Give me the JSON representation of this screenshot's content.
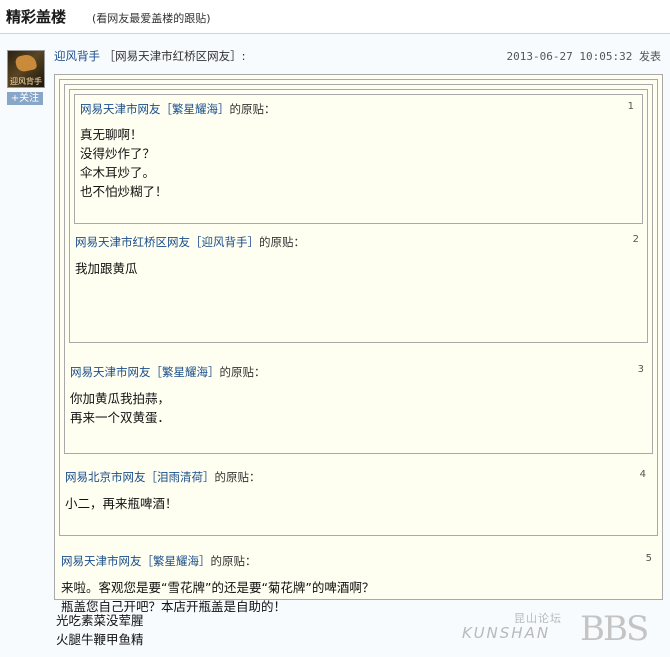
{
  "header": {
    "title": "精彩盖楼",
    "subtitle": "(看网友最爱盖楼的跟贴)"
  },
  "post": {
    "avatar_caption": "迎风背手",
    "follow_label": "+关注",
    "username": "迎风背手",
    "location": "［网易天津市红桥区网友］:",
    "timestamp": "2013-06-27 10:05:32 发表"
  },
  "quotes": [
    {
      "who": "网易天津市网友［繁星耀海］",
      "orig": "的原贴：",
      "num": "1",
      "lines": [
        "真无聊啊！",
        "没得炒作了？",
        "伞木耳炒了。",
        "也不怕炒糊了！"
      ]
    },
    {
      "who": "网易天津市红桥区网友［迎风背手］",
      "orig": "的原贴：",
      "num": "2",
      "lines": [
        "我加跟黄瓜"
      ]
    },
    {
      "who": "网易天津市网友［繁星耀海］",
      "orig": "的原贴：",
      "num": "3",
      "lines": [
        "你加黄瓜我拍蒜，",
        "再来一个双黄蛋．"
      ]
    },
    {
      "who": "网易北京市网友［泪雨清荷］",
      "orig": "的原贴：",
      "num": "4",
      "lines": [
        "小二，再来瓶啤酒！"
      ]
    },
    {
      "who": "网易天津市网友［繁星耀海］",
      "orig": "的原贴：",
      "num": "5",
      "lines": [
        "来啦。客观您是要“雪花牌”的还是要“菊花牌”的啤酒啊？",
        "瓶盖您自己开吧？本店开瓶盖是自助的！"
      ]
    }
  ],
  "reply": {
    "lines": [
      "光吃素菜没荤腥",
      "火腿牛鞭甲鱼精"
    ]
  },
  "watermark": {
    "cn": "昆山论坛",
    "en": "KUNSHAN",
    "big": "BBS"
  }
}
